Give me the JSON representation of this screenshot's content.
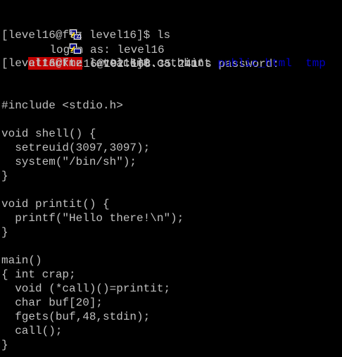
{
  "terminal": {
    "colors": {
      "background": "#000000",
      "foreground": "#c0c0c0",
      "executable_highlight": "#c00000",
      "directory": "#0000c8"
    },
    "login_prompt": "login as: level16",
    "password_prompt": "level16@192.168.35.241's password:",
    "cmd_ls": "[level16@ftz level16]$ ls",
    "ls_output": {
      "attackme": "attackme",
      "attackme_c": "attackme.c",
      "hint": "hint",
      "public_html": "public_html",
      "tmp": "tmp"
    },
    "cmd_cat": "[level16@ftz level16]$ cat hint",
    "code": {
      "include": "#include <stdio.h>",
      "shell_sig": "void shell() {",
      "shell_setreuid": "  setreuid(3097,3097);",
      "shell_system": "  system(\"/bin/sh\");",
      "shell_close": "}",
      "printit_sig": "void printit() {",
      "printit_printf": "  printf(\"Hello there!\\n\");",
      "printit_close": "}",
      "main_sig": "main()",
      "main_int": "{ int crap;",
      "main_call_ptr": "  void (*call)()=printit;",
      "main_buf": "  char buf[20];",
      "main_fgets": "  fgets(buf,48,stdin);",
      "main_call": "  call();",
      "main_close": "}"
    }
  }
}
